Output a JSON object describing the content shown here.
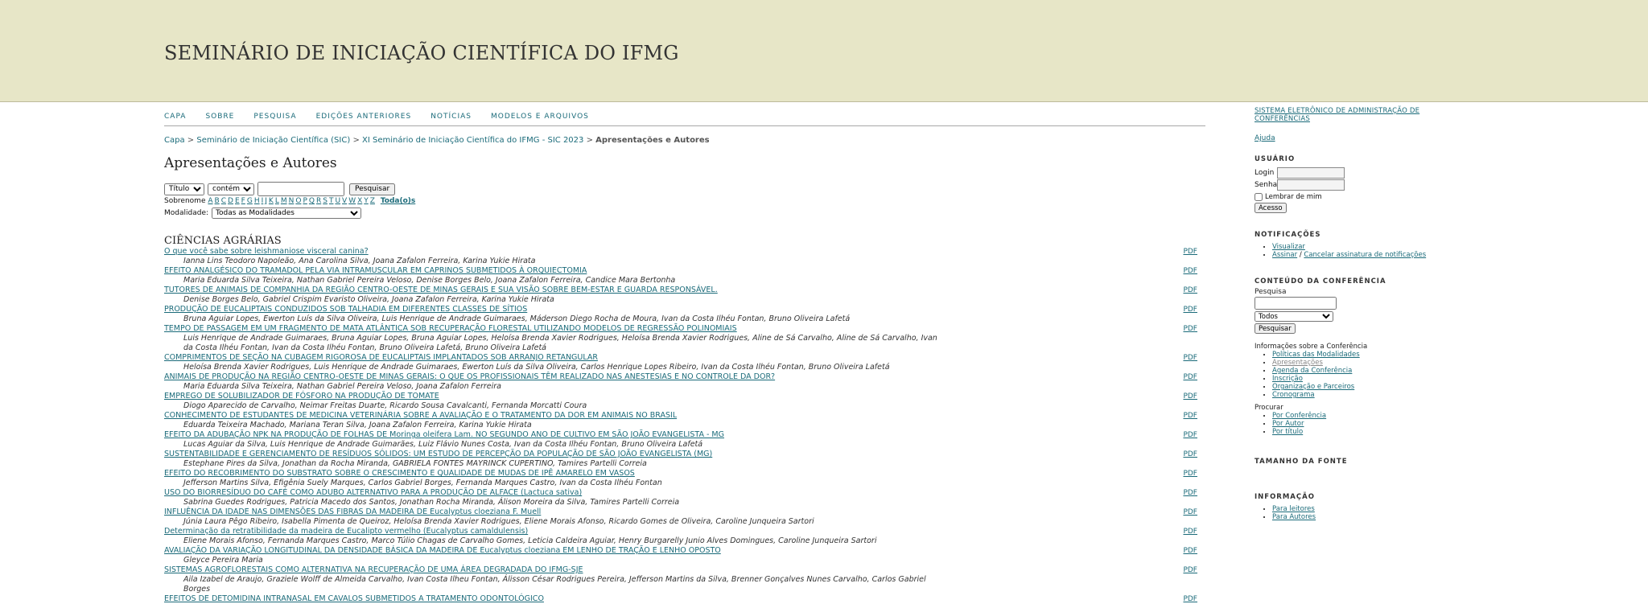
{
  "site": {
    "title": "SEMINÁRIO DE INICIAÇÃO CIENTÍFICA DO IFMG"
  },
  "nav": [
    {
      "label": "CAPA"
    },
    {
      "label": "SOBRE"
    },
    {
      "label": "PESQUISA"
    },
    {
      "label": "EDIÇÕES ANTERIORES"
    },
    {
      "label": "NOTÍCIAS"
    },
    {
      "label": "MODELOS E ARQUIVOS"
    }
  ],
  "breadcrumb": {
    "items": [
      "Capa",
      "Seminário de Iniciação Científica (SIC)",
      "XI Seminário de Iniciação Científica do IFMG - SIC 2023"
    ],
    "separator": ">",
    "current": "Apresentações e Autores"
  },
  "page": {
    "title": "Apresentações e Autores"
  },
  "search": {
    "field_selected": "Título",
    "match_selected": "contém",
    "query_value": "",
    "button": "Pesquisar",
    "surname_label": "Sobrenome",
    "letters": [
      "A",
      "B",
      "C",
      "D",
      "E",
      "F",
      "G",
      "H",
      "I",
      "J",
      "K",
      "L",
      "M",
      "N",
      "O",
      "P",
      "Q",
      "R",
      "S",
      "T",
      "U",
      "V",
      "W",
      "X",
      "Y",
      "Z"
    ],
    "all_label": "Toda(o)s",
    "modality_label": "Modalidade:",
    "modality_selected": "Todas as Modalidades"
  },
  "section": {
    "title": "CIÊNCIAS AGRÁRIAS"
  },
  "pdf_label": "PDF",
  "articles": [
    {
      "title": "O que você sabe sobre leishmaniose visceral canina?",
      "authors": "Ianna Lins Teodoro Napoleão, Ana Carolina Silva, Joana Zafalon Ferreira, Karina Yukie Hirata"
    },
    {
      "title": "EFEITO ANALGÉSICO DO TRAMADOL PELA VIA INTRAMUSCULAR EM CAPRINOS SUBMETIDOS À ORQUIECTOMIA",
      "authors": "Maria Eduarda Silva Teixeira, Nathan Gabriel Pereira Veloso, Denise Borges Belo, Joana Zafalon Ferreira, Candice Mara Bertonha"
    },
    {
      "title": "TUTORES DE ANIMAIS DE COMPANHIA DA REGIÃO CENTRO-OESTE DE MINAS GERAIS E SUA VISÃO SOBRE BEM-ESTAR E GUARDA RESPONSÁVEL.",
      "authors": "Denise Borges Belo, Gabriel Crispim Evaristo Oliveira, Joana Zafalon Ferreira, Karina Yukie Hirata"
    },
    {
      "title": "PRODUÇÃO DE EUCALIPTAIS CONDUZIDOS SOB TALHADIA EM DIFERENTES CLASSES DE SÍTIOS",
      "authors": "Bruna Aguiar Lopes, Ewerton Luís da Silva Oliveira, Luis Henrique de Andrade Guimaraes, Máderson Diego Rocha de Moura, Ivan da Costa Ilhéu Fontan, Bruno Oliveira Lafetá"
    },
    {
      "title": "TEMPO DE PASSAGEM EM UM FRAGMENTO DE MATA ATLÂNTICA SOB RECUPERAÇÃO FLORESTAL UTILIZANDO MODELOS DE REGRESSÃO POLINOMIAIS",
      "authors": "Luis Henrique de Andrade Guimaraes, Bruna Aguiar Lopes, Bruna Aguiar Lopes, Heloísa Brenda Xavier Rodrigues, Heloísa Brenda Xavier Rodrigues, Aline de Sá Carvalho, Aline de Sá Carvalho, Ivan da Costa Ilhéu Fontan, Ivan da Costa Ilhéu Fontan, Bruno Oliveira Lafetá, Bruno Oliveira Lafetá"
    },
    {
      "title": "COMPRIMENTOS DE SEÇÃO NA CUBAGEM RIGOROSA DE EUCALIPTAIS IMPLANTADOS SOB ARRANJO RETANGULAR",
      "authors": "Heloísa Brenda Xavier Rodrigues, Luis Henrique de Andrade Guimaraes, Ewerton Luís da Silva Oliveira, Carlos Henrique Lopes Ribeiro, Ivan da Costa Ilhéu Fontan, Bruno Oliveira Lafetá"
    },
    {
      "title": "ANIMAIS DE PRODUÇÃO NA REGIÃO CENTRO-OESTE DE MINAS GERAIS: O QUE OS PROFISSIONAIS TÊM REALIZADO NAS ANESTESIAS E NO CONTROLE DA DOR?",
      "authors": "Maria Eduarda Silva Teixeira, Nathan Gabriel Pereira Veloso, Joana Zafalon Ferreira"
    },
    {
      "title": "EMPREGO DE SOLUBILIZADOR DE FÓSFORO NA PRODUÇÃO DE TOMATE",
      "authors": "Diogo Aparecido de Carvalho, Neimar Freitas Duarte, Ricardo Sousa Cavalcanti, Fernanda Morcatti Coura"
    },
    {
      "title": "CONHECIMENTO DE ESTUDANTES DE MEDICINA VETERINÁRIA SOBRE A AVALIAÇÃO E O TRATAMENTO DA DOR EM ANIMAIS NO BRASIL",
      "authors": "Eduarda Teixeira Machado, Mariana Teran Silva, Joana Zafalon Ferreira, Karina Yukie Hirata"
    },
    {
      "title": "EFEITO DA ADUBAÇÃO NPK NA PRODUÇÃO DE FOLHAS DE Moringa oleifera Lam. NO SEGUNDO ANO DE CULTIVO EM SÃO JOÃO EVANGELISTA - MG",
      "authors": "Lucas Aguiar da Silva, Luis Henrique de Andrade Guimarães, Luiz Flávio Nunes Costa, Ivan da Costa Ilhéu Fontan, Bruno Oliveira Lafetá"
    },
    {
      "title": "SUSTENTABILIDADE E GERENCIAMENTO DE RESÍDUOS SÓLIDOS: UM ESTUDO DE PERCEPÇÃO DA POPULAÇÃO DE SÃO JOÃO EVANGELISTA (MG)",
      "authors": "Estephane Pires da Silva, Jonathan da Rocha Miranda, GABRIELA FONTES MAYRINCK CUPERTINO, Tamires Partelli Correia"
    },
    {
      "title": "EFEITO DO RECOBRIMENTO DO SUBSTRATO SOBRE O CRESCIMENTO E QUALIDADE DE MUDAS DE IPÊ AMARELO EM VASOS",
      "authors": "Jefferson Martins Silva, Efigênia Suely Marques, Carlos Gabriel Borges, Fernanda Marques Castro, Ivan da Costa Ilhéu Fontan"
    },
    {
      "title": "USO DO BIORRESÍDUO DO CAFÉ COMO ADUBO ALTERNATIVO PARA A PRODUÇÃO DE ALFACE (Lactuca sativa)",
      "authors": "Sabrina Guedes Rodrigues, Patricia Macedo dos Santos, Jonathan Rocha Miranda, Álison Moreira da Silva, Tamires Partelli Correia"
    },
    {
      "title": "INFLUÊNCIA DA IDADE NAS DIMENSÕES DAS FIBRAS DA MADEIRA DE Eucalyptus cloeziana F. Muell",
      "authors": "Júnia Laura Pêgo Ribeiro, Isabella Pimenta de Queiroz, Heloísa Brenda Xavier Rodrigues, Eliene Morais Afonso, Ricardo Gomes de Oliveira, Caroline Junqueira Sartori"
    },
    {
      "title": "Determinação da retratibilidade da madeira de Eucalipto vermelho (Eucalyptus camaldulensis)",
      "authors": "Eliene Morais Afonso, Fernanda Marques Castro, Marco Túlio Chagas de Carvalho Gomes, Leticia Caldeira Aguiar, Henry Burgarelly Junio Alves Domingues, Caroline Junqueira Sartori"
    },
    {
      "title": "AVALIAÇÃO DA VARIAÇÃO LONGITUDINAL DA DENSIDADE BÁSICA DA MADEIRA DE Eucalyptus cloeziana EM LENHO DE TRAÇÃO E LENHO OPOSTO",
      "authors": "Gleyce Pereira Maria"
    },
    {
      "title": "SISTEMAS AGROFLORESTAIS COMO ALTERNATIVA NA RECUPERAÇÃO DE UMA ÁREA DEGRADADA DO IFMG-SJE",
      "authors": "Aila Izabel de Araujo, Graziele Wolff de Almeida Carvalho, Ivan Costa Ilheu Fontan, Álisson César Rodrigues Pereira, Jefferson Martins da Silva, Brenner Gonçalves Nunes Carvalho, Carlos Gabriel Borges"
    },
    {
      "title": "EFEITOS DE DETOMIDINA INTRANASAL EM CAVALOS SUBMETIDOS A TRATAMENTO ODONTOLÓGICO",
      "authors": ""
    }
  ],
  "sidebar": {
    "top_link": "SISTEMA ELETRÔNICO DE ADMINISTRAÇÃO DE CONFERÊNCIAS",
    "help": "Ajuda",
    "user": {
      "heading": "USUÁRIO",
      "login_label": "Login",
      "password_label": "Senha",
      "remember_label": "Lembrar de mim",
      "button": "Acesso"
    },
    "notifications": {
      "heading": "NOTIFICAÇÕES",
      "view": "Visualizar",
      "subscribe": "Assinar",
      "slash": " / ",
      "unsubscribe": "Cancelar assinatura de notificações"
    },
    "content": {
      "heading": "CONTEÚDO DA CONFERÊNCIA",
      "search_label": "Pesquisa",
      "scope_selected": "Todos",
      "search_button": "Pesquisar",
      "info_label": "Informações sobre a Conferência",
      "info_links": [
        "Políticas das Modalidades",
        "Apresentações",
        "Agenda da Conferência",
        "Inscrição",
        "Organização e Parceiros",
        "Cronograma"
      ],
      "browse_label": "Procurar",
      "browse_links": [
        "Por Conferência",
        "Por Autor",
        "Por título"
      ]
    },
    "font_size": {
      "heading": "TAMANHO DA FONTE"
    },
    "information": {
      "heading": "INFORMAÇÃO",
      "links": [
        "Para leitores",
        "Para Autores"
      ]
    }
  }
}
